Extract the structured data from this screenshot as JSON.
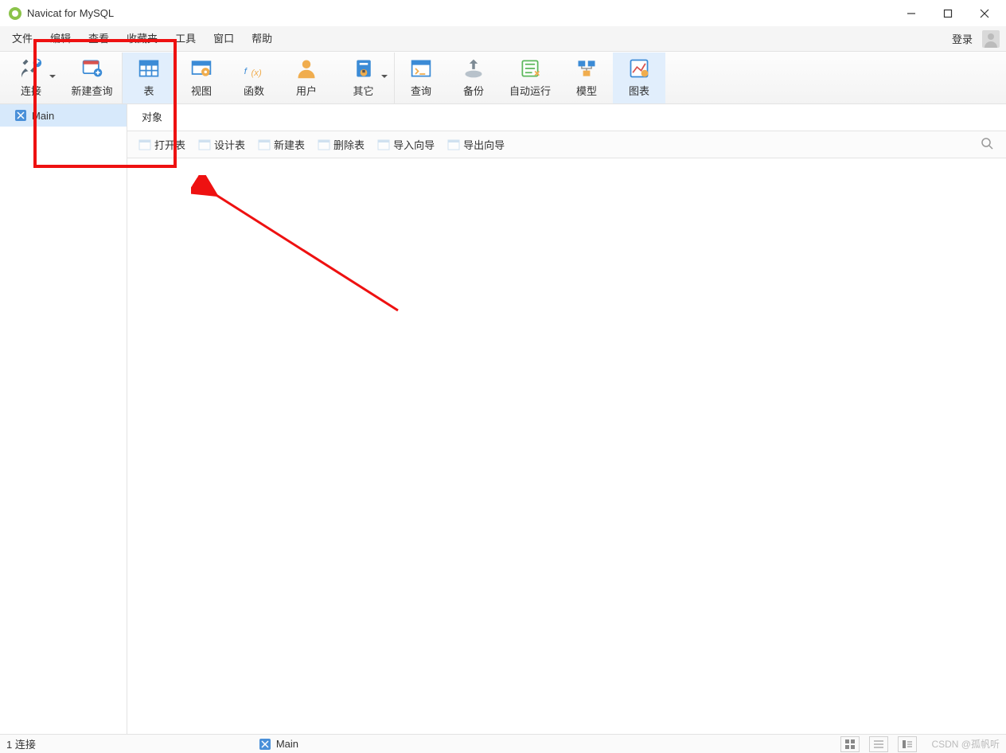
{
  "window": {
    "title": "Navicat for MySQL"
  },
  "menu": {
    "items": [
      "文件",
      "编辑",
      "查看",
      "收藏夹",
      "工具",
      "窗口",
      "帮助"
    ],
    "login": "登录"
  },
  "toolbar": {
    "items": [
      {
        "id": "connection",
        "label": "连接",
        "icon": "#ic-plug",
        "drop": true
      },
      {
        "id": "new-query",
        "label": "新建查询",
        "icon": "#ic-newquery",
        "sep": true
      },
      {
        "id": "table",
        "label": "表",
        "icon": "#ic-table",
        "active": true
      },
      {
        "id": "view",
        "label": "视图",
        "icon": "#ic-view"
      },
      {
        "id": "function",
        "label": "函数",
        "icon": "#ic-fx"
      },
      {
        "id": "user",
        "label": "用户",
        "icon": "#ic-user"
      },
      {
        "id": "other",
        "label": "其它",
        "icon": "#ic-other",
        "drop": true,
        "sep": true
      },
      {
        "id": "query",
        "label": "查询",
        "icon": "#ic-query"
      },
      {
        "id": "backup",
        "label": "备份",
        "icon": "#ic-backup"
      },
      {
        "id": "auto-run",
        "label": "自动运行",
        "icon": "#ic-auto"
      },
      {
        "id": "model",
        "label": "模型",
        "icon": "#ic-model"
      },
      {
        "id": "chart",
        "label": "图表",
        "icon": "#ic-chart",
        "active": true
      }
    ]
  },
  "sidebar": {
    "items": [
      {
        "label": "Main"
      }
    ]
  },
  "tabs": [
    {
      "label": "对象"
    }
  ],
  "subtool": {
    "items": [
      {
        "id": "open-table",
        "label": "打开表"
      },
      {
        "id": "design-table",
        "label": "设计表"
      },
      {
        "id": "new-table",
        "label": "新建表"
      },
      {
        "id": "delete-table",
        "label": "删除表"
      },
      {
        "id": "import-wizard",
        "label": "导入向导"
      },
      {
        "id": "export-wizard",
        "label": "导出向导"
      }
    ]
  },
  "status": {
    "connections": "1 连接",
    "current": "Main",
    "watermark": "CSDN @孤帆听"
  }
}
